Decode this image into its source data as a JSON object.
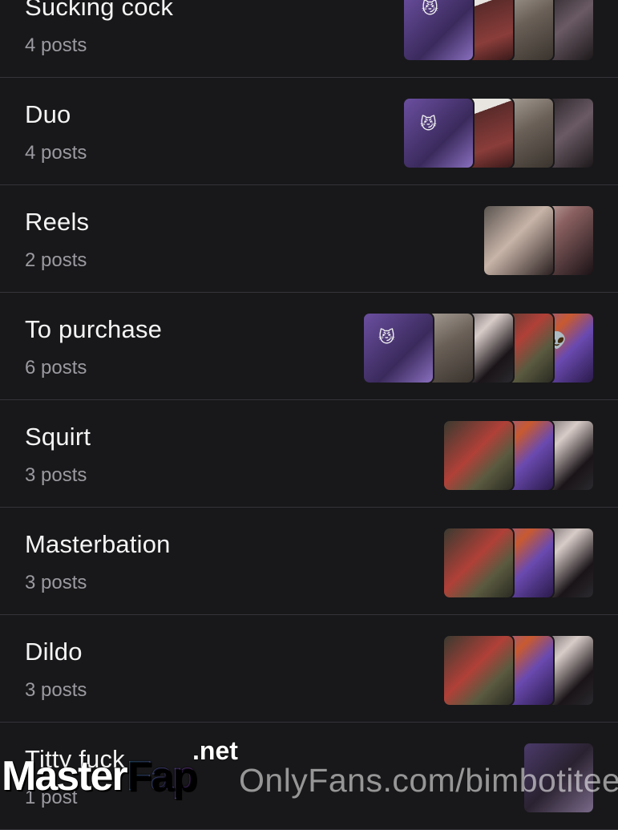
{
  "lists": [
    {
      "title": "Sucking cock",
      "count": "4 posts",
      "thumbs": [
        "t1",
        "t2",
        "t3",
        "t4"
      ]
    },
    {
      "title": "Duo",
      "count": "4 posts",
      "thumbs": [
        "t1",
        "t2",
        "t3",
        "t4"
      ]
    },
    {
      "title": "Reels",
      "count": "2 posts",
      "thumbs": [
        "t5",
        "t6"
      ]
    },
    {
      "title": "To purchase",
      "count": "6 posts",
      "thumbs": [
        "t1",
        "t3",
        "t9",
        "t7",
        "t8"
      ]
    },
    {
      "title": "Squirt",
      "count": "3 posts",
      "thumbs": [
        "t7",
        "t8",
        "t9"
      ]
    },
    {
      "title": "Masterbation",
      "count": "3 posts",
      "thumbs": [
        "t7",
        "t8",
        "t9"
      ]
    },
    {
      "title": "Dildo",
      "count": "3 posts",
      "thumbs": [
        "t7",
        "t8",
        "t9"
      ]
    },
    {
      "title": "Titty fuck",
      "count": "1 post",
      "thumbs": [
        "t10"
      ]
    }
  ],
  "watermark": {
    "master": "Master",
    "fap": "Fap",
    "net": ".net",
    "onlyfans": "OnlyFans.com/bimbotitee"
  }
}
